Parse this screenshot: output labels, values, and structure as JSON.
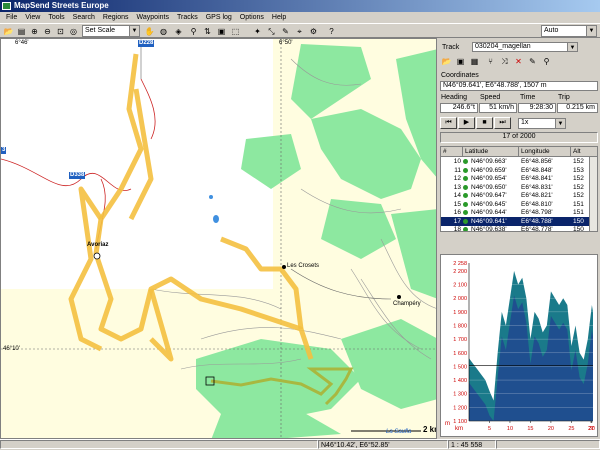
{
  "window": {
    "title": "MapSend Streets Europe"
  },
  "menu": [
    "File",
    "View",
    "Tools",
    "Search",
    "Regions",
    "Waypoints",
    "Tracks",
    "GPS log",
    "Options",
    "Help"
  ],
  "toolbar": {
    "scale": "Set Scale",
    "mode": "Auto"
  },
  "map": {
    "grid_labels": [
      "6°46'",
      "6°50'",
      "46°10'"
    ],
    "road_badges": [
      "D228",
      "D338",
      "3"
    ],
    "places": [
      "Avoriaz",
      "Les Crosets",
      "Champéry",
      "La Saufla"
    ],
    "scale_label": "2 km"
  },
  "panel": {
    "track_label": "Track",
    "track_value": "030204_magellan",
    "coords_label": "Coordinates",
    "coords_value": "N46°09.641', E6°48.788', 1507 m",
    "heading_label": "Heading",
    "speed_label": "Speed",
    "time_label": "Time",
    "trip_label": "Trip",
    "heading": "246.6°t",
    "speed": "51 km/h",
    "time": "9:28:30",
    "trip": "0.215 km",
    "speed_mult": "1x",
    "counter": "17 of 2000",
    "table": {
      "headers": [
        "#",
        "Latitude",
        "Longitude",
        "Alt"
      ],
      "rows": [
        {
          "n": "10",
          "lat": "N46°09.663'",
          "lon": "E6°48.856'",
          "alt": "152"
        },
        {
          "n": "11",
          "lat": "N46°09.659'",
          "lon": "E6°48.848'",
          "alt": "153"
        },
        {
          "n": "12",
          "lat": "N46°09.654'",
          "lon": "E6°48.841'",
          "alt": "152"
        },
        {
          "n": "13",
          "lat": "N46°09.650'",
          "lon": "E6°48.831'",
          "alt": "152"
        },
        {
          "n": "14",
          "lat": "N46°09.647'",
          "lon": "E6°48.821'",
          "alt": "152"
        },
        {
          "n": "15",
          "lat": "N46°09.645'",
          "lon": "E6°48.810'",
          "alt": "151"
        },
        {
          "n": "16",
          "lat": "N46°09.644'",
          "lon": "E6°48.798'",
          "alt": "151"
        },
        {
          "n": "17",
          "lat": "N46°09.641'",
          "lon": "E6°48.788'",
          "alt": "150"
        },
        {
          "n": "18",
          "lat": "N46°09.638'",
          "lon": "E6°48.778'",
          "alt": "150"
        }
      ]
    }
  },
  "chart_data": {
    "type": "area",
    "yunit": "m",
    "xunit": "km",
    "y_ticks": [
      "2 258",
      "2 200",
      "2 100",
      "2 000",
      "1 900",
      "1 800",
      "1 700",
      "1 600",
      "1 500",
      "1 400",
      "1 300",
      "1 200",
      "1 100"
    ],
    "x_ticks": [
      "5",
      "10",
      "15",
      "20",
      "25",
      "30",
      "27"
    ],
    "ylim": [
      1100,
      2258
    ],
    "xlim": [
      0,
      30.27
    ],
    "x": [
      0,
      1,
      2,
      3,
      4,
      5,
      6,
      7,
      8,
      9,
      10,
      11,
      12,
      13,
      14,
      15,
      16,
      17,
      18,
      19,
      20,
      21,
      22,
      23,
      24,
      25,
      26,
      27,
      28,
      29,
      30,
      30.27
    ],
    "values": [
      1560,
      1520,
      1480,
      1440,
      1400,
      1320,
      1250,
      1600,
      1900,
      1800,
      2000,
      2200,
      2100,
      2150,
      2000,
      1700,
      1900,
      1850,
      1750,
      1800,
      2050,
      2000,
      1950,
      2000,
      1950,
      1650,
      1800,
      1600,
      1550,
      1700,
      1950,
      1900
    ]
  },
  "status": {
    "coords": "N46°10.42', E6°52.85'",
    "scale": "1 : 45 558"
  }
}
